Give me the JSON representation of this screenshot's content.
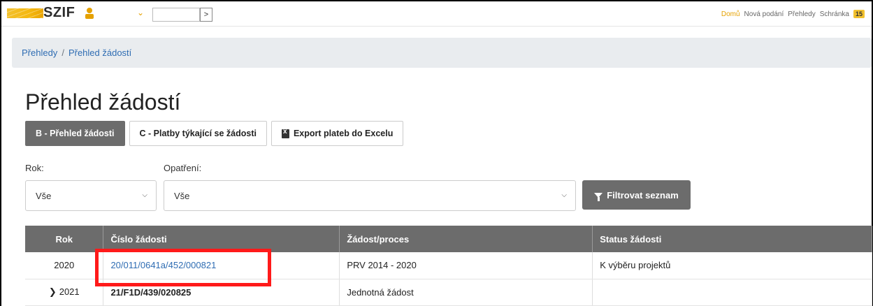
{
  "header": {
    "logo_text": "SZIF",
    "nav_links": [
      "Domů",
      "Nová podání",
      "Přehledy",
      "Schránka"
    ],
    "inbox_count": "15",
    "go_symbol": ">"
  },
  "breadcrumb": [
    "Přehledy",
    "Přehled žádostí"
  ],
  "page_title": "Přehled žádostí",
  "tabs": [
    {
      "label": "B - Přehled žádosti"
    },
    {
      "label": "C - Platby týkající se žádosti"
    },
    {
      "label": "Export plateb do Excelu"
    }
  ],
  "filters": {
    "year_label": "Rok:",
    "year_value": "Vše",
    "measure_label": "Opatření:",
    "measure_value": "Vše",
    "filter_button": "Filtrovat seznam"
  },
  "table": {
    "headers": [
      "Rok",
      "Číslo žádosti",
      "Žádost/proces",
      "Status žádosti"
    ],
    "rows": [
      {
        "rok": "2020",
        "cislo": "20/011/0641a/452/000821",
        "proces": "PRV 2014 - 2020",
        "status": "K výběru projektů"
      },
      {
        "rok": "2021",
        "cislo": "21/F1D/439/020825",
        "proces": "Jednotná žádost",
        "status": ""
      }
    ]
  },
  "colors": {
    "accent": "#f2c12e",
    "highlight": "#ff1a1a",
    "header_bg": "#6c6c6c",
    "link": "#2f6db3"
  }
}
